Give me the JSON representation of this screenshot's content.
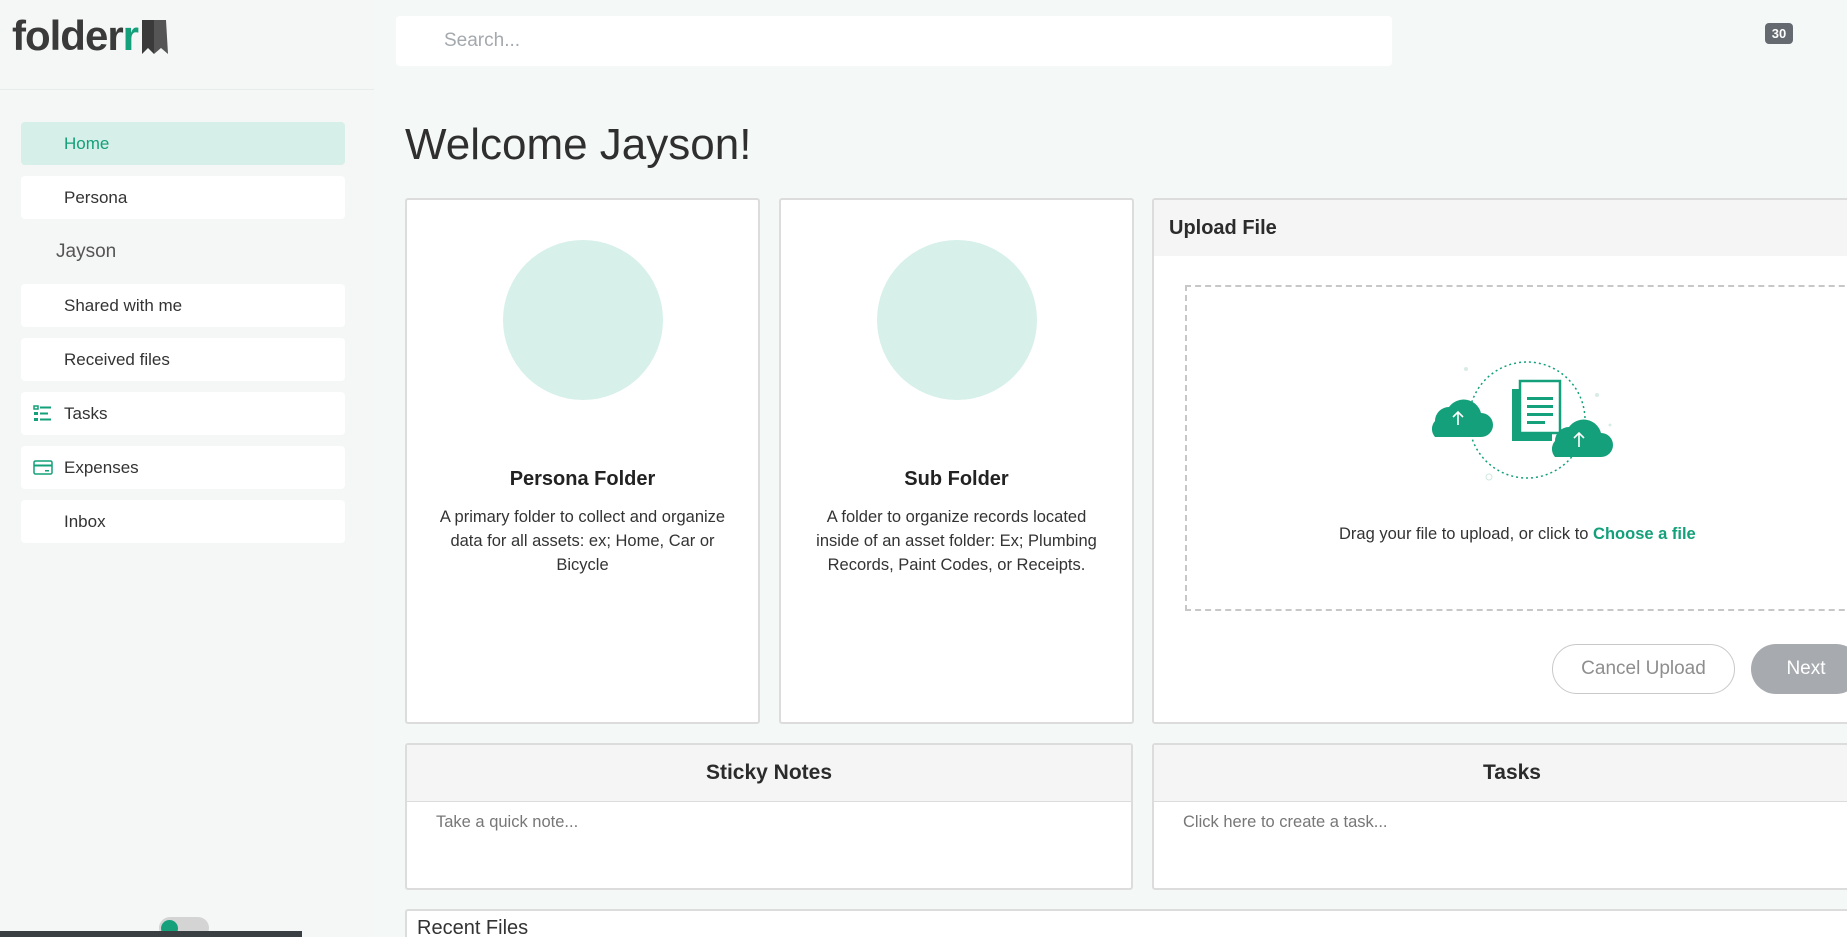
{
  "app": {
    "logo_text_main": "folder",
    "logo_text_accent": "r"
  },
  "search": {
    "placeholder": "Search..."
  },
  "header": {
    "badge_count": "30"
  },
  "sidebar": {
    "items": [
      {
        "label": "Home",
        "active": true,
        "icon": "none"
      },
      {
        "label": "Persona",
        "active": false,
        "icon": "none"
      },
      {
        "label": "Jayson",
        "plain": true
      },
      {
        "label": "Shared with me",
        "active": false,
        "icon": "none"
      },
      {
        "label": "Received files",
        "active": false,
        "icon": "none"
      },
      {
        "label": "Tasks",
        "active": false,
        "icon": "tasks-list-icon"
      },
      {
        "label": "Expenses",
        "active": false,
        "icon": "credit-card-icon"
      },
      {
        "label": "Inbox",
        "active": false,
        "icon": "none"
      }
    ]
  },
  "main": {
    "welcome": "Welcome Jayson!",
    "persona_folder": {
      "title": "Persona Folder",
      "description": "A primary folder to collect and organize data for all assets: ex; Home, Car or Bicycle"
    },
    "sub_folder": {
      "title": "Sub Folder",
      "description": "A folder to organize records located inside of an asset folder: Ex; Plumbing Records, Paint Codes, or Receipts."
    },
    "upload": {
      "title": "Upload File",
      "drop_text": "Drag your file to upload, or click to",
      "choose_label": "Choose a file",
      "cancel_label": "Cancel Upload",
      "next_label": "Next"
    },
    "sticky_notes": {
      "title": "Sticky Notes",
      "placeholder": "Take a quick note..."
    },
    "tasks": {
      "title": "Tasks",
      "placeholder": "Click here to create a task..."
    },
    "recent_files": {
      "title": "Recent Files"
    }
  },
  "colors": {
    "accent": "#13a07a",
    "accent_light": "#d6efe8",
    "background": "#f4f8f6"
  }
}
